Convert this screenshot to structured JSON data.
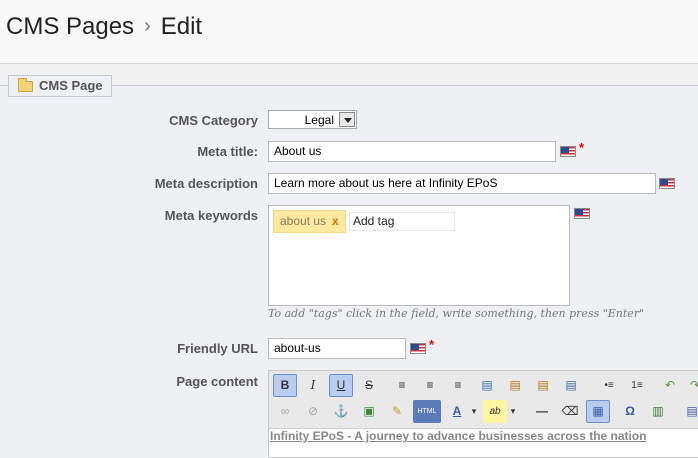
{
  "breadcrumb": {
    "parent": "CMS Pages",
    "separator": "›",
    "current": "Edit"
  },
  "section": {
    "legend": "CMS Page"
  },
  "form": {
    "category": {
      "label": "CMS Category",
      "value": "Legal"
    },
    "meta_title": {
      "label": "Meta title:",
      "value": "About us",
      "required": "*"
    },
    "meta_description": {
      "label": "Meta description",
      "value": "Learn more about us here at Infinity EPoS"
    },
    "meta_keywords": {
      "label": "Meta keywords",
      "tags": [
        "about us"
      ],
      "tag_remove": "x",
      "add_tag_placeholder": "Add tag",
      "hint": "To add \"tags\" click in the field, write something, then press \"Enter\""
    },
    "friendly_url": {
      "label": "Friendly URL",
      "value": "about-us",
      "required": "*"
    },
    "page_content": {
      "label": "Page content",
      "content_link": "Infinity EPoS - A journey to advance businesses across the nation"
    }
  },
  "toolbar": {
    "row1": [
      "B",
      "I",
      "U",
      "S",
      "≡",
      "≡",
      "≡",
      "▤",
      "▤",
      "▤",
      "▤",
      "•≡",
      "1≡",
      "↶",
      "↷"
    ],
    "row2": [
      "∞",
      "⊘",
      "⚓",
      "▣",
      "✎",
      "HTML",
      "A",
      "▾",
      "ab",
      "▾",
      "—",
      "⌫",
      "▦",
      "Ω",
      "▥",
      "▤"
    ]
  },
  "colors": {
    "accent": "#6e8fcc",
    "tag_bg": "#fde9a0",
    "required": "#e00000"
  }
}
